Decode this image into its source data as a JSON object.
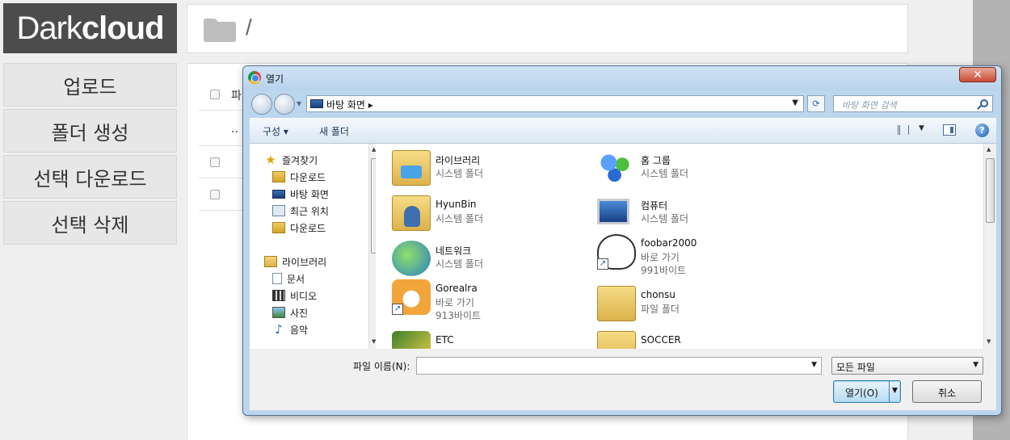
{
  "app": {
    "logo_part1": "Dark",
    "logo_part2": "cloud",
    "path": "/",
    "sidebar": [
      {
        "label": "업로드"
      },
      {
        "label": "폴더 생성"
      },
      {
        "label": "선택 다운로드"
      },
      {
        "label": "선택 삭제"
      }
    ],
    "content_rows": [
      {
        "checkbox": true,
        "text": "파"
      },
      {
        "checkbox": false,
        "text": ".."
      },
      {
        "checkbox": true,
        "text": ""
      },
      {
        "checkbox": true,
        "text": ""
      }
    ]
  },
  "dialog": {
    "title": "열기",
    "close_symbol": "✕",
    "address": "바탕 화면 ▸",
    "search_placeholder": "바탕 화면 검색",
    "toolbar": {
      "organize": "구성 ▾",
      "new_folder": "새 폴더",
      "help": "?"
    },
    "nav": {
      "favorites": [
        {
          "label": "즐겨찾기",
          "icon": "star-icon"
        },
        {
          "label": "다운로드",
          "icon": "download-folder-icon"
        },
        {
          "label": "바탕 화면",
          "icon": "desktop-icon"
        },
        {
          "label": "최근 위치",
          "icon": "recent-places-icon"
        },
        {
          "label": "다운로드",
          "icon": "download-folder-icon"
        }
      ],
      "libraries": [
        {
          "label": "라이브러리",
          "icon": "library-icon"
        },
        {
          "label": "문서",
          "icon": "documents-icon"
        },
        {
          "label": "비디오",
          "icon": "video-icon"
        },
        {
          "label": "사진",
          "icon": "pictures-icon"
        },
        {
          "label": "음악",
          "icon": "music-icon"
        }
      ]
    },
    "files": [
      {
        "name": "라이브러리",
        "desc": "시스템 폴더",
        "size": "",
        "icon": "library-folder-icon",
        "shortcut": false
      },
      {
        "name": "홈 그룹",
        "desc": "시스템 폴더",
        "size": "",
        "icon": "homegroup-icon",
        "shortcut": false
      },
      {
        "name": "HyunBin",
        "desc": "시스템 폴더",
        "size": "",
        "icon": "user-folder-icon",
        "shortcut": false
      },
      {
        "name": "컴퓨터",
        "desc": "시스템 폴더",
        "size": "",
        "icon": "computer-icon",
        "shortcut": false
      },
      {
        "name": "네트워크",
        "desc": "시스템 폴더",
        "size": "",
        "icon": "network-icon",
        "shortcut": false
      },
      {
        "name": "foobar2000",
        "desc": "바로 가기",
        "size": "991바이트",
        "icon": "foobar-icon",
        "shortcut": true
      },
      {
        "name": "Gorealra",
        "desc": "바로 가기",
        "size": "913바이트",
        "icon": "gorealra-icon",
        "shortcut": true
      },
      {
        "name": "chonsu",
        "desc": "파일 폴더",
        "size": "",
        "icon": "folder-icon",
        "shortcut": false
      },
      {
        "name": "ETC",
        "desc": "",
        "size": "",
        "icon": "etc-icon",
        "shortcut": false
      },
      {
        "name": "SOCCER",
        "desc": "",
        "size": "",
        "icon": "folder-icon",
        "shortcut": false
      }
    ],
    "filename_label": "파일 이름(N):",
    "filename_value": "",
    "filetype_value": "모든 파일",
    "open_label": "열기(O)",
    "cancel_label": "취소"
  }
}
